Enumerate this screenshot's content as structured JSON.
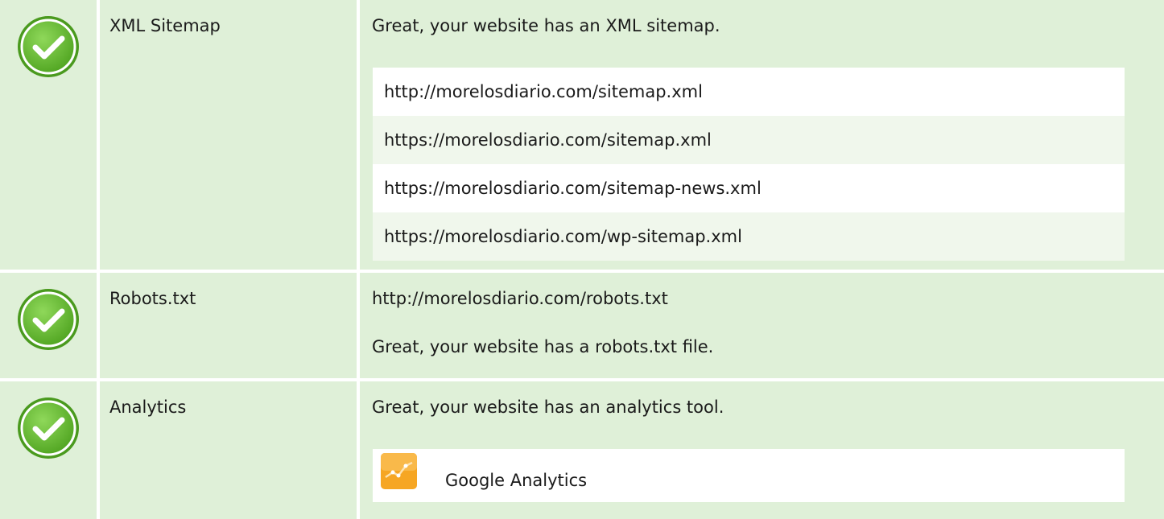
{
  "checks": [
    {
      "label": "XML Sitemap",
      "message": "Great, your website has an XML sitemap.",
      "urls": [
        "http://morelosdiario.com/sitemap.xml",
        "https://morelosdiario.com/sitemap.xml",
        "https://morelosdiario.com/sitemap-news.xml",
        "https://morelosdiario.com/wp-sitemap.xml"
      ]
    },
    {
      "label": "Robots.txt",
      "url": "http://morelosdiario.com/robots.txt",
      "message": "Great, your website has a robots.txt file."
    },
    {
      "label": "Analytics",
      "message": "Great, your website has an analytics tool.",
      "tool": {
        "name": "Google Analytics",
        "icon": "google-analytics-icon"
      }
    }
  ],
  "colors": {
    "row_background": "#dff0d8",
    "check_green": "#6cc13b",
    "check_ring": "#ffffff",
    "analytics_orange": "#f6a623"
  },
  "status_icon": "check-circle-icon"
}
